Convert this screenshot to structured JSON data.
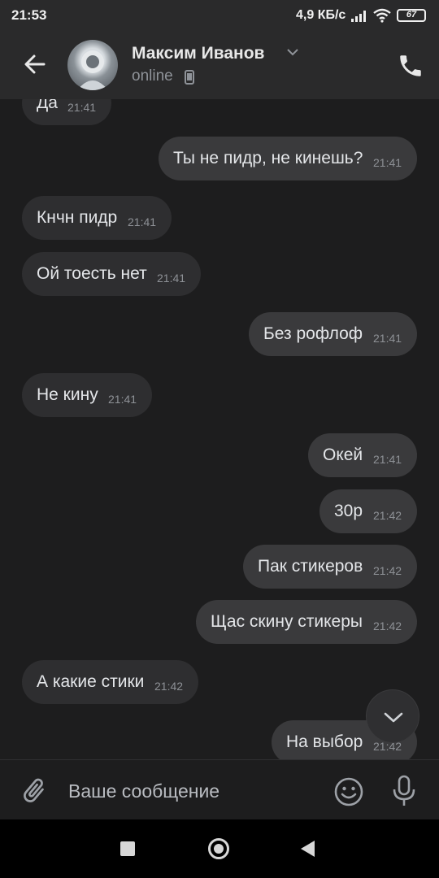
{
  "status_bar": {
    "time": "21:53",
    "network_speed": "4,9 КБ/с",
    "battery": "67"
  },
  "header": {
    "contact_name": "Максим Иванов",
    "contact_status": "online"
  },
  "messages": [
    {
      "dir": "in",
      "text": "Да",
      "time": "21:41"
    },
    {
      "dir": "out",
      "text": "Ты не пидр, не кинешь?",
      "time": "21:41"
    },
    {
      "dir": "in",
      "text": "Кнчн пидр",
      "time": "21:41"
    },
    {
      "dir": "in",
      "text": "Ой тоесть нет",
      "time": "21:41"
    },
    {
      "dir": "out",
      "text": "Без рофлоф",
      "time": "21:41"
    },
    {
      "dir": "in",
      "text": "Не кину",
      "time": "21:41"
    },
    {
      "dir": "out",
      "text": "Окей",
      "time": "21:41"
    },
    {
      "dir": "out",
      "text": "30р",
      "time": "21:42"
    },
    {
      "dir": "out",
      "text": "Пак стикеров",
      "time": "21:42"
    },
    {
      "dir": "out",
      "text": "Щас скину стикеры",
      "time": "21:42"
    },
    {
      "dir": "in",
      "text": "А какие стики",
      "time": "21:42"
    },
    {
      "dir": "out",
      "text": "На выбор",
      "time": "21:42"
    }
  ],
  "composer": {
    "placeholder": "Ваше сообщение"
  },
  "icons": {
    "back": "arrow-left-icon",
    "call": "phone-icon",
    "attach": "paperclip-icon",
    "emoji": "smiley-icon",
    "mic": "microphone-icon",
    "scroll": "chevron-down-icon"
  },
  "colors": {
    "background": "#1d1d1e",
    "header": "#2a2a2b",
    "bubble_in": "#2e2e30",
    "bubble_out": "#3a3a3c",
    "timestamp": "#8e9196"
  }
}
